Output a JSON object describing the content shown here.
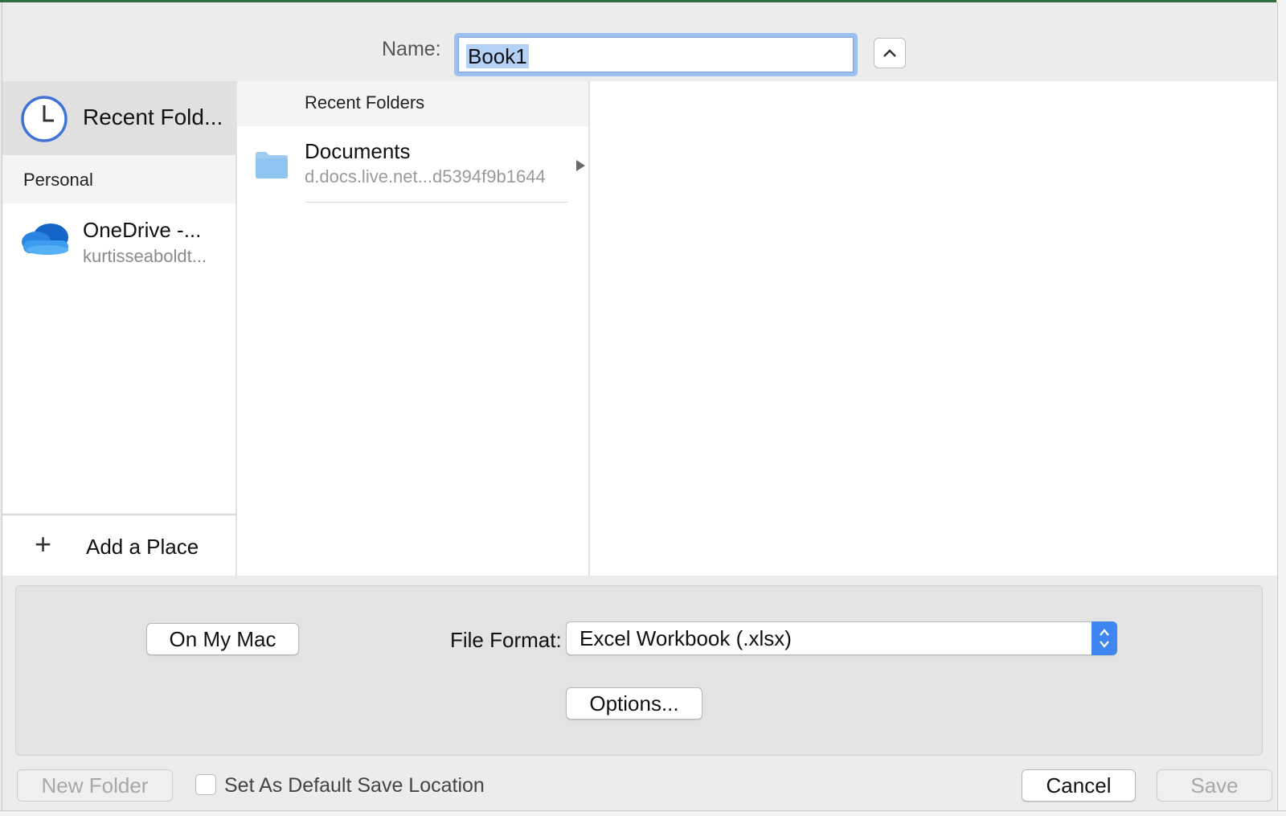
{
  "dialog": {
    "name_label": "Name:",
    "name_value": "Book1"
  },
  "sidebar": {
    "recent_label": "Recent Fold...",
    "section_personal": "Personal",
    "onedrive_title": "OneDrive -...",
    "onedrive_subtitle": "kurtisseaboldt...",
    "add_place_label": "Add a Place"
  },
  "recent_folders": {
    "header": "Recent Folders",
    "items": [
      {
        "name": "Documents",
        "location": "d.docs.live.net...d5394f9b1644"
      }
    ]
  },
  "options_panel": {
    "on_my_mac_label": "On My Mac",
    "file_format_label": "File Format:",
    "file_format_value": "Excel Workbook (.xlsx)",
    "options_button_label": "Options..."
  },
  "footer": {
    "new_folder_label": "New Folder",
    "default_location_label": "Set As Default Save Location",
    "default_location_checked": false,
    "cancel_label": "Cancel",
    "save_label": "Save"
  },
  "colors": {
    "accent": "#3f87f0",
    "selection": "#b4d2f7",
    "onedrive": "#1e74d4"
  }
}
